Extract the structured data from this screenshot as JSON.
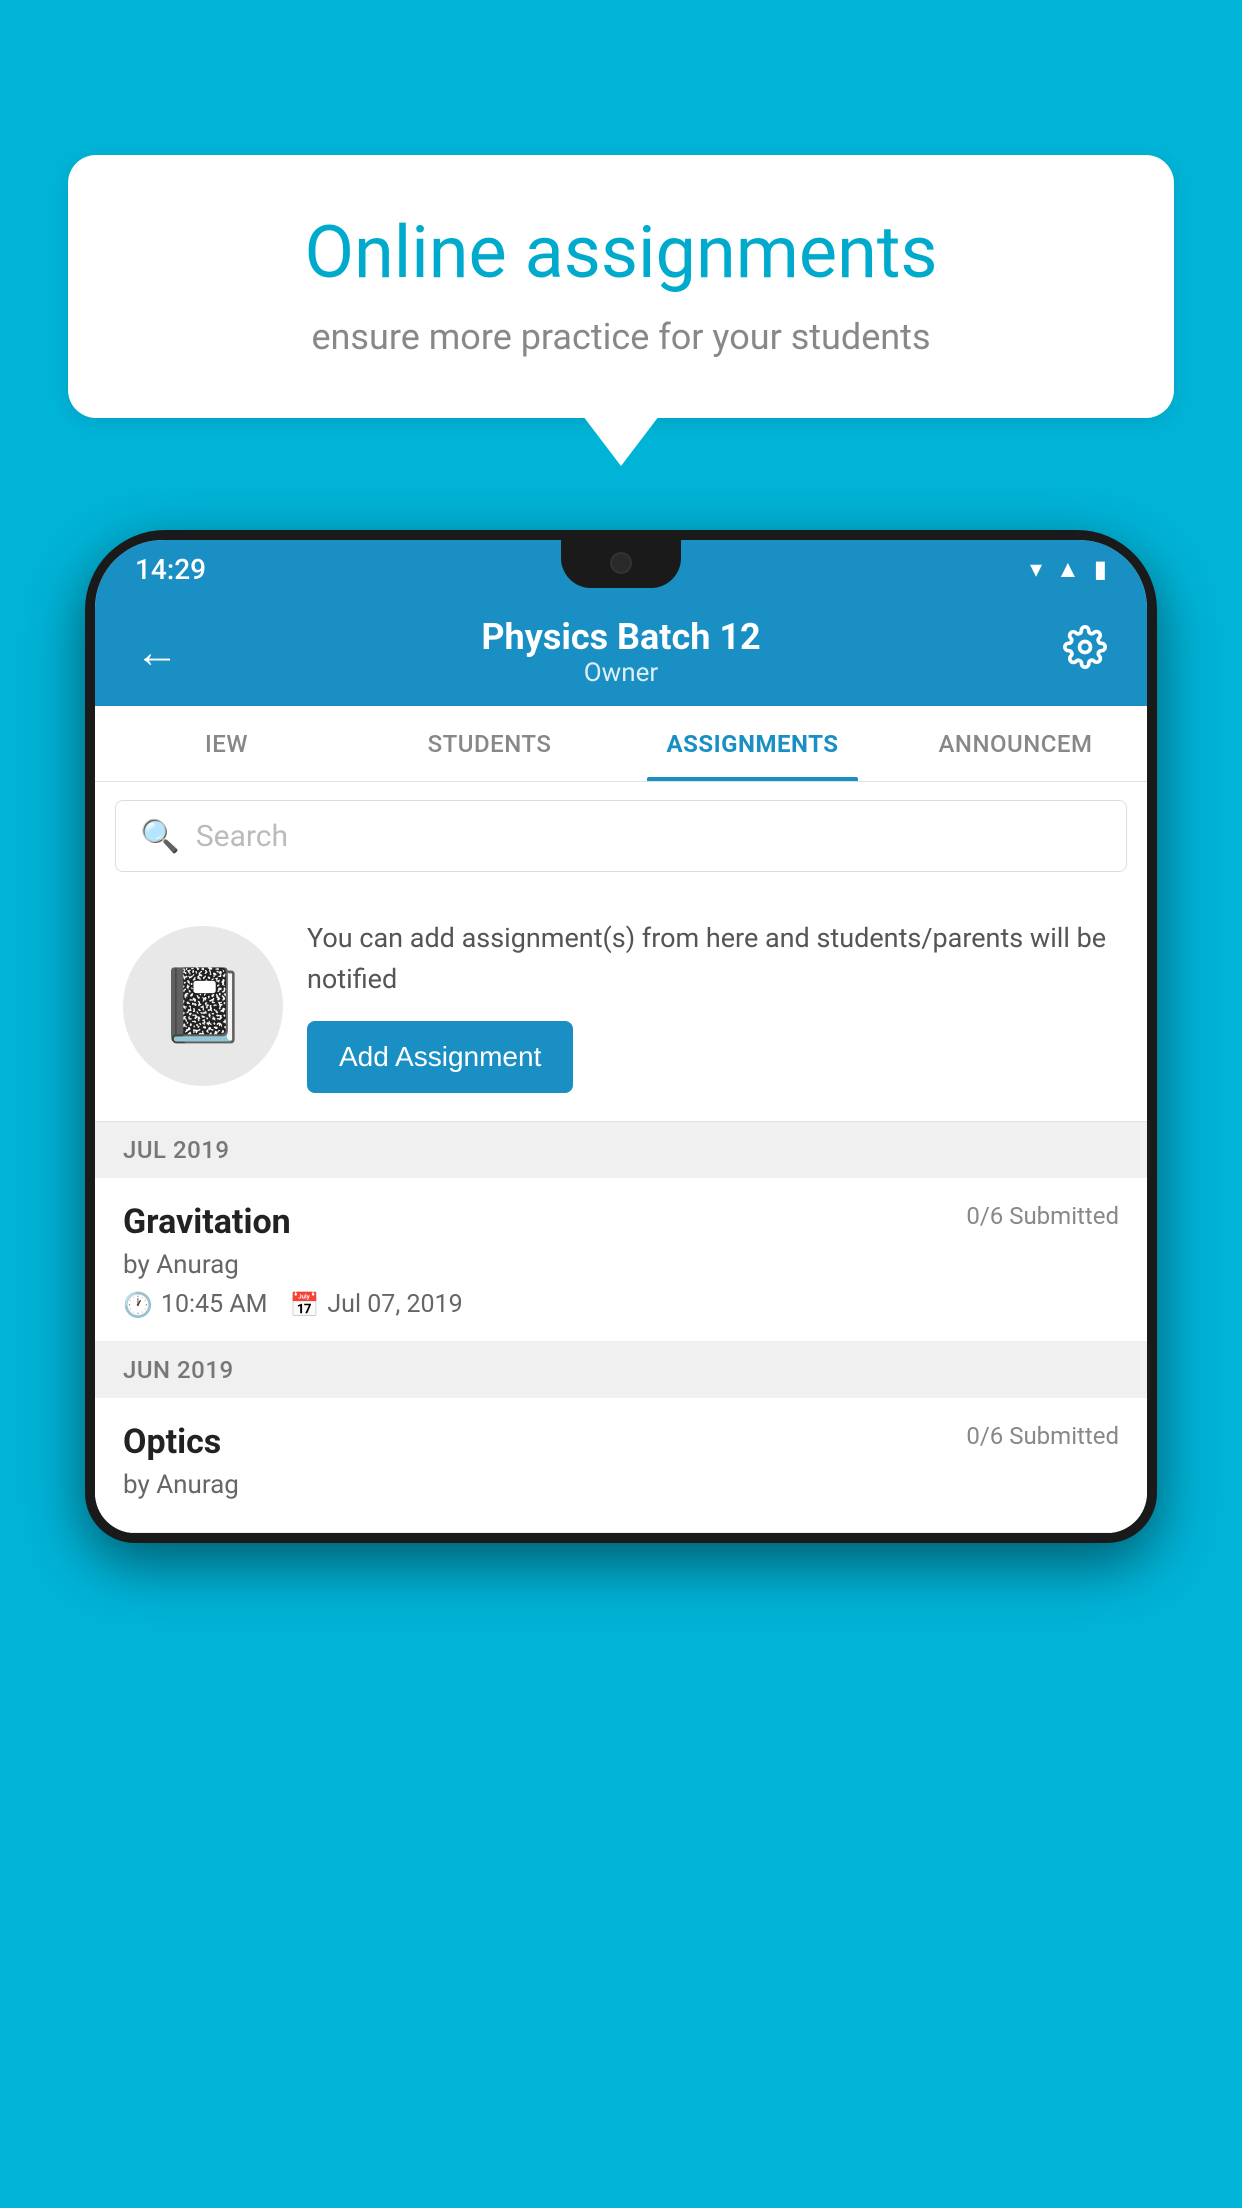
{
  "background_color": "#00b4d8",
  "speech_bubble": {
    "title": "Online assignments",
    "subtitle": "ensure more practice for your students"
  },
  "phone": {
    "status_bar": {
      "time": "14:29",
      "wifi_icon": "▾",
      "signal_icon": "▲",
      "battery_icon": "▮"
    },
    "app_bar": {
      "back_label": "←",
      "title": "Physics Batch 12",
      "subtitle": "Owner",
      "settings_label": "⚙"
    },
    "tabs": [
      {
        "label": "IEW",
        "active": false
      },
      {
        "label": "STUDENTS",
        "active": false
      },
      {
        "label": "ASSIGNMENTS",
        "active": true
      },
      {
        "label": "ANNOUNCEM",
        "active": false
      }
    ],
    "search": {
      "placeholder": "Search"
    },
    "promo": {
      "text": "You can add assignment(s) from here and students/parents will be notified",
      "button_label": "Add Assignment"
    },
    "sections": [
      {
        "label": "JUL 2019",
        "assignments": [
          {
            "name": "Gravitation",
            "submitted": "0/6 Submitted",
            "author": "by Anurag",
            "time": "10:45 AM",
            "date": "Jul 07, 2019"
          }
        ]
      },
      {
        "label": "JUN 2019",
        "assignments": [
          {
            "name": "Optics",
            "submitted": "0/6 Submitted",
            "author": "by Anurag",
            "time": "",
            "date": ""
          }
        ]
      }
    ]
  }
}
